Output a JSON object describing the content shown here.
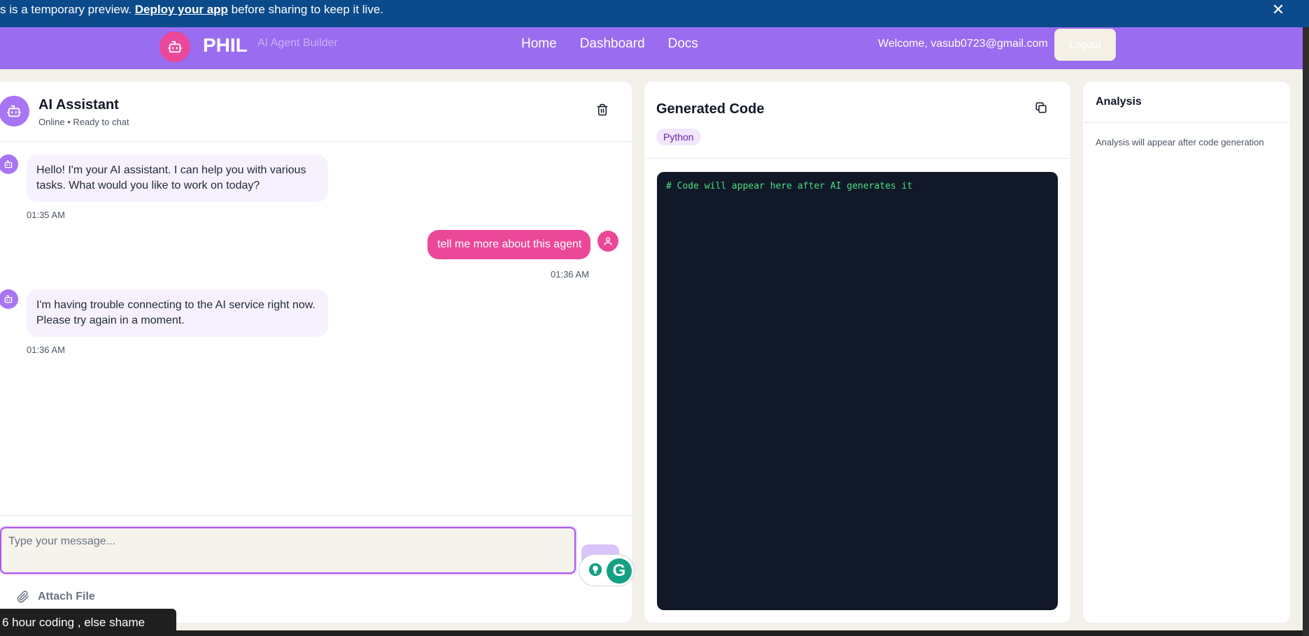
{
  "banner": {
    "prefix": "s is a temporary preview. ",
    "link": "Deploy your app",
    "suffix": " before sharing to keep it live.",
    "close": "✕"
  },
  "nav": {
    "brand": "PHIL",
    "tagline": "AI Agent Builder",
    "links": [
      "Home",
      "Dashboard",
      "Docs"
    ],
    "welcome": "Welcome, vasub0723@gmail.com",
    "logout": "Logout"
  },
  "chat": {
    "title": "AI Assistant",
    "status": "Online • Ready to chat",
    "messages": [
      {
        "role": "bot",
        "text": "Hello! I'm your AI assistant. I can help you with various tasks. What would you like to work on today?",
        "time": "01:35 AM"
      },
      {
        "role": "user",
        "text": "tell me more about this agent",
        "time": "01:36 AM"
      },
      {
        "role": "bot",
        "text": "I'm having trouble connecting to the AI service right now. Please try again in a moment.",
        "time": "01:36 AM"
      }
    ],
    "input_placeholder": "Type your message...",
    "attach_label": "Attach File"
  },
  "code": {
    "title": "Generated Code",
    "language": "Python",
    "content": "# Code will appear here after AI generates it"
  },
  "analysis": {
    "title": "Analysis",
    "placeholder": "Analysis will appear after code generation"
  },
  "taskbar": {
    "tooltip": "6 hour coding , else shame"
  },
  "colors": {
    "banner": "#0b4a8b",
    "nav": "#9a6cf0",
    "accent_pink": "#ec4899",
    "accent_purple": "#a875f5",
    "code_bg": "#111827",
    "code_text": "#4ade80"
  }
}
